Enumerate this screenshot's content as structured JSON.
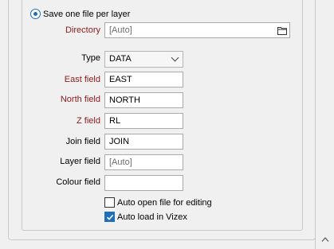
{
  "save_mode": {
    "label": "Save one file per layer",
    "selected": true
  },
  "directory": {
    "label": "Directory",
    "value": "[Auto]",
    "icon": "folder-icon"
  },
  "type": {
    "label": "Type",
    "value": "DATA"
  },
  "fields": {
    "east": {
      "label": "East field",
      "value": "EAST"
    },
    "north": {
      "label": "North field",
      "value": "NORTH"
    },
    "z": {
      "label": "Z field",
      "value": "RL"
    },
    "join": {
      "label": "Join field",
      "value": "JOIN"
    },
    "layer": {
      "label": "Layer field",
      "value": "[Auto]"
    },
    "colour": {
      "label": "Colour field",
      "value": ""
    }
  },
  "options": {
    "auto_open": {
      "label": "Auto open file for editing",
      "checked": false
    },
    "auto_load": {
      "label": "Auto load in Vizex",
      "checked": true
    }
  },
  "colors": {
    "required_label": "#8b1a1a",
    "accent": "#1f6fb8"
  }
}
